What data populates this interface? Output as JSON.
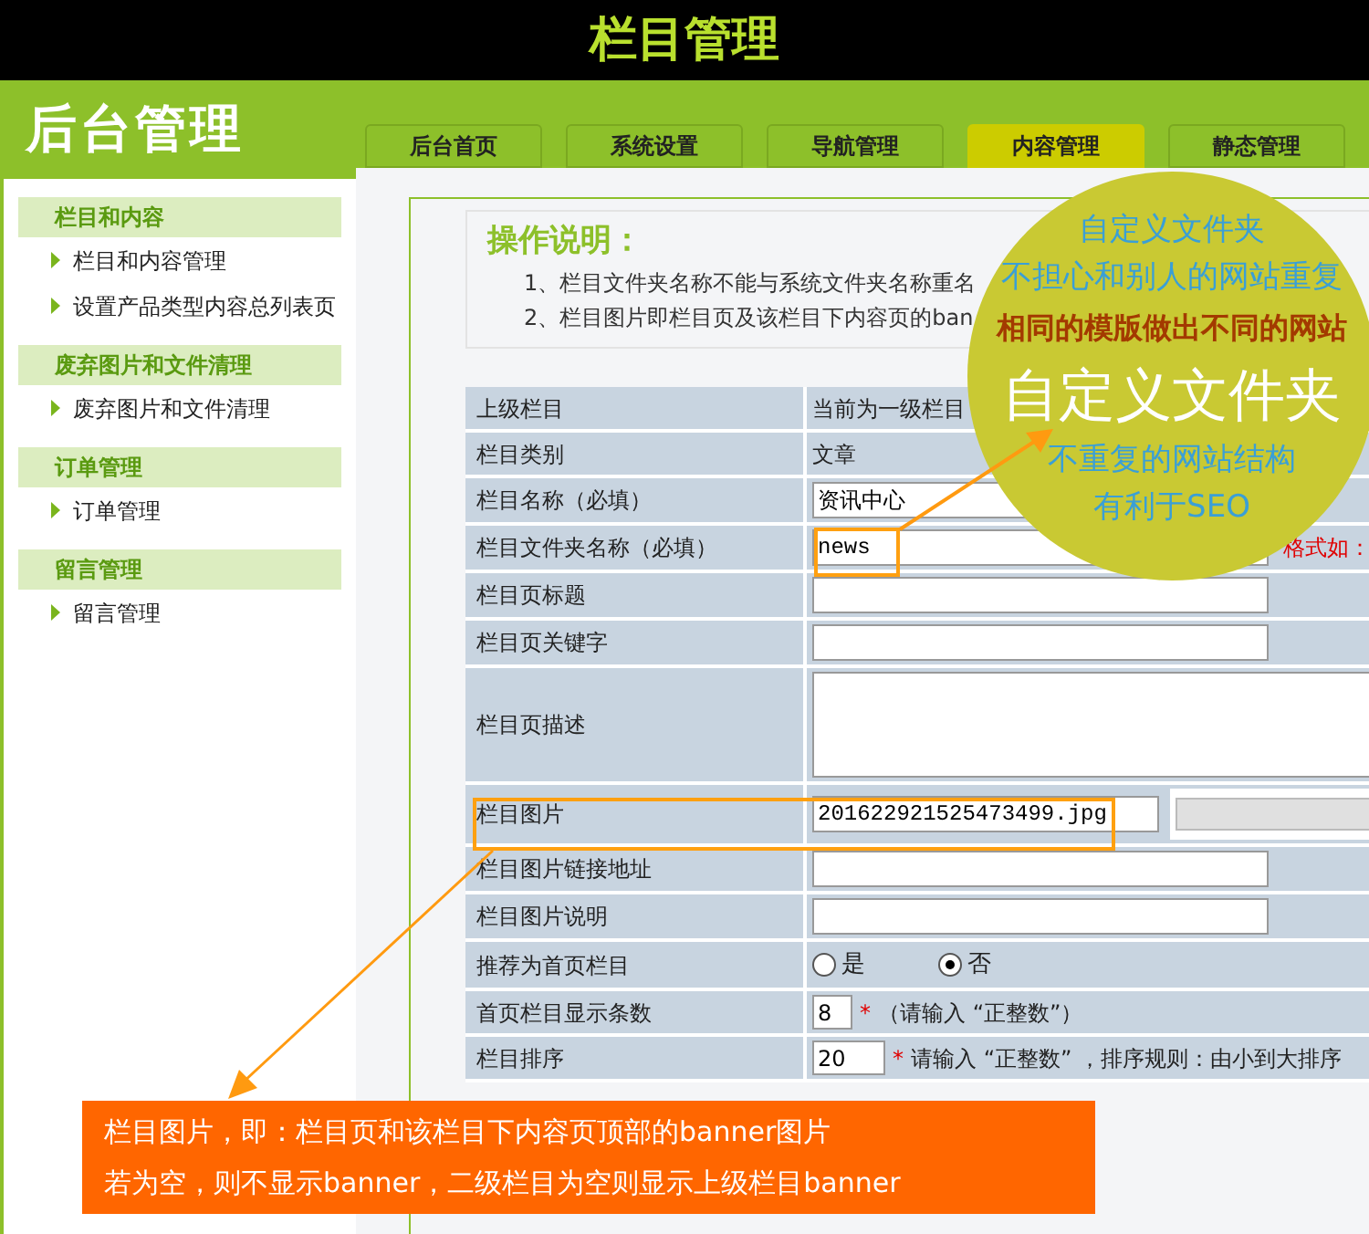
{
  "header": {
    "title": "栏目管理"
  },
  "logo": {
    "text": "后台管理"
  },
  "sidebar": {
    "sections": [
      {
        "title": "栏目和内容",
        "items": [
          "栏目和内容管理",
          "设置产品类型内容总列表页"
        ]
      },
      {
        "title": "废弃图片和文件清理",
        "items": [
          "废弃图片和文件清理"
        ]
      },
      {
        "title": "订单管理",
        "items": [
          "订单管理"
        ]
      },
      {
        "title": "留言管理",
        "items": [
          "留言管理"
        ]
      }
    ]
  },
  "tabs": [
    {
      "label": "后台首页",
      "selected": false
    },
    {
      "label": "系统设置",
      "selected": false
    },
    {
      "label": "导航管理",
      "selected": false
    },
    {
      "label": "内容管理",
      "selected": true
    },
    {
      "label": "静态管理",
      "selected": false
    }
  ],
  "instructions": {
    "title": "操作说明：",
    "lines": [
      "1、栏目文件夹名称不能与系统文件夹名称重名",
      "2、栏目图片即栏目页及该栏目下内容页的ban"
    ]
  },
  "form": {
    "rows": [
      {
        "label": "上级栏目",
        "kind": "text",
        "value": "当前为一级栏目"
      },
      {
        "label": "栏目类别",
        "kind": "text",
        "value": "文章"
      },
      {
        "label": "栏目名称（必填）",
        "kind": "input",
        "value": "资讯中心"
      },
      {
        "label": "栏目文件夹名称（必填）",
        "kind": "input",
        "value": "news",
        "hint": "格式如："
      },
      {
        "label": "栏目页标题",
        "kind": "input"
      },
      {
        "label": "栏目页关键字",
        "kind": "input"
      },
      {
        "label": "栏目页描述",
        "kind": "textarea"
      },
      {
        "label": "栏目图片",
        "kind": "file",
        "value": "201622921525473499.jpg"
      },
      {
        "label": "栏目图片链接地址",
        "kind": "input"
      },
      {
        "label": "栏目图片说明",
        "kind": "input"
      },
      {
        "label": "推荐为首页栏目",
        "kind": "radio",
        "options": [
          {
            "label": "是",
            "selected": false
          },
          {
            "label": "否",
            "selected": true
          }
        ]
      },
      {
        "label": "首页栏目显示条数",
        "kind": "number",
        "value": "8",
        "required": "*",
        "note": "（请输入 “正整数”）"
      },
      {
        "label": "栏目排序",
        "kind": "number",
        "value": "20",
        "required": "*",
        "note": "请输入 “正整数” ，排序规则：由小到大排序"
      }
    ]
  },
  "callout_circle": {
    "lines": [
      {
        "text": "自定义文件夹",
        "kind": "subtitle"
      },
      {
        "text": "不担心和别人的网站重复",
        "kind": "subtitle"
      },
      {
        "text": "相同的模版做出不同的网站",
        "kind": "slogan"
      },
      {
        "text": "自定义文件夹",
        "kind": "headline"
      },
      {
        "text": "不重复的网站结构",
        "kind": "subtitle"
      },
      {
        "text": "有利于SEO",
        "kind": "subtitle"
      }
    ]
  },
  "callout_box": {
    "lines": [
      "栏目图片，即：栏目页和该栏目下内容页顶部的banner图片",
      "若为空，则不显示banner，二级栏目为空则显示上级栏目banner"
    ]
  }
}
